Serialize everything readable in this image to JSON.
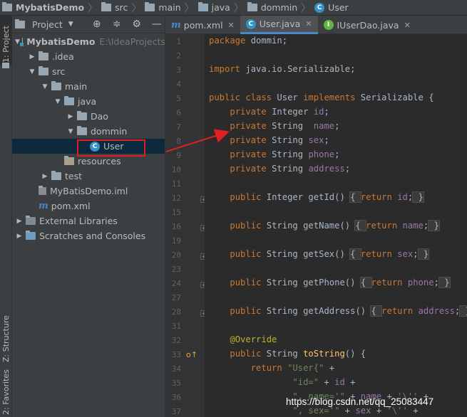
{
  "breadcrumb": [
    "MybatisDemo",
    "src",
    "main",
    "java",
    "dommin",
    "User"
  ],
  "side_strip": {
    "project": "1: Project",
    "structure": "Z: Structure",
    "favorites": "2: Favorites"
  },
  "project_panel": {
    "title": "Project",
    "tree": [
      {
        "label": "MybatisDemo",
        "hint": "E:\\IdeaProjects",
        "depth": 0,
        "arrow": "down",
        "icon": "module"
      },
      {
        "label": ".idea",
        "depth": 1,
        "arrow": "right",
        "icon": "folder"
      },
      {
        "label": "src",
        "depth": 1,
        "arrow": "down",
        "icon": "folder"
      },
      {
        "label": "main",
        "depth": 2,
        "arrow": "down",
        "icon": "folder"
      },
      {
        "label": "java",
        "depth": 3,
        "arrow": "down",
        "icon": "folder-src"
      },
      {
        "label": "Dao",
        "depth": 4,
        "arrow": "right",
        "icon": "package"
      },
      {
        "label": "dommin",
        "depth": 4,
        "arrow": "down",
        "icon": "package"
      },
      {
        "label": "User",
        "depth": 5,
        "arrow": "none",
        "icon": "class",
        "selected": true
      },
      {
        "label": "resources",
        "depth": 3,
        "arrow": "none",
        "icon": "folder-res"
      },
      {
        "label": "test",
        "depth": 2,
        "arrow": "right",
        "icon": "folder"
      },
      {
        "label": "MyBatisDemo.iml",
        "depth": 1,
        "arrow": "none",
        "icon": "iml"
      },
      {
        "label": "pom.xml",
        "depth": 1,
        "arrow": "none",
        "icon": "maven"
      },
      {
        "label": "External Libraries",
        "depth": 0,
        "arrow": "right",
        "icon": "libraries"
      },
      {
        "label": "Scratches and Consoles",
        "depth": 0,
        "arrow": "right",
        "icon": "scratches"
      }
    ]
  },
  "tabs": [
    {
      "label": "pom.xml",
      "icon": "m",
      "active": false
    },
    {
      "label": "User.java",
      "icon": "class",
      "active": true
    },
    {
      "label": "IUserDao.java",
      "icon": "interface",
      "active": false
    }
  ],
  "code_lines": [
    {
      "n": "1",
      "t": "package dommin;"
    },
    {
      "n": "2",
      "t": ""
    },
    {
      "n": "3",
      "t": "import java.io.Serializable;"
    },
    {
      "n": "4",
      "t": ""
    },
    {
      "n": "5",
      "t": "public class User implements Serializable {"
    },
    {
      "n": "6",
      "t": "    private Integer id;"
    },
    {
      "n": "7",
      "t": "    private String  name;"
    },
    {
      "n": "8",
      "t": "    private String sex;"
    },
    {
      "n": "9",
      "t": "    private String phone;"
    },
    {
      "n": "10",
      "t": "    private String address;"
    },
    {
      "n": "11",
      "t": ""
    },
    {
      "n": "12",
      "t": "    public Integer getId() { return id; }"
    },
    {
      "n": "15",
      "t": ""
    },
    {
      "n": "16",
      "t": "    public String getName() { return name; }"
    },
    {
      "n": "19",
      "t": ""
    },
    {
      "n": "20",
      "t": "    public String getSex() { return sex; }"
    },
    {
      "n": "23",
      "t": ""
    },
    {
      "n": "24",
      "t": "    public String getPhone() { return phone; }"
    },
    {
      "n": "27",
      "t": ""
    },
    {
      "n": "28",
      "t": "    public String getAddress() { return address; }"
    },
    {
      "n": "31",
      "t": ""
    },
    {
      "n": "32",
      "t": "    @Override"
    },
    {
      "n": "33",
      "t": "    public String toString() {"
    },
    {
      "n": "34",
      "t": "        return \"User{\" +"
    },
    {
      "n": "35",
      "t": "                \"id=\" + id +"
    },
    {
      "n": "36",
      "t": "                \", name='\" + name + '\\'' +"
    },
    {
      "n": "37",
      "t": "                \", sex='\" + sex + '\\'' +"
    }
  ],
  "watermark": "https://blog.csdn.net/qq_25083447"
}
